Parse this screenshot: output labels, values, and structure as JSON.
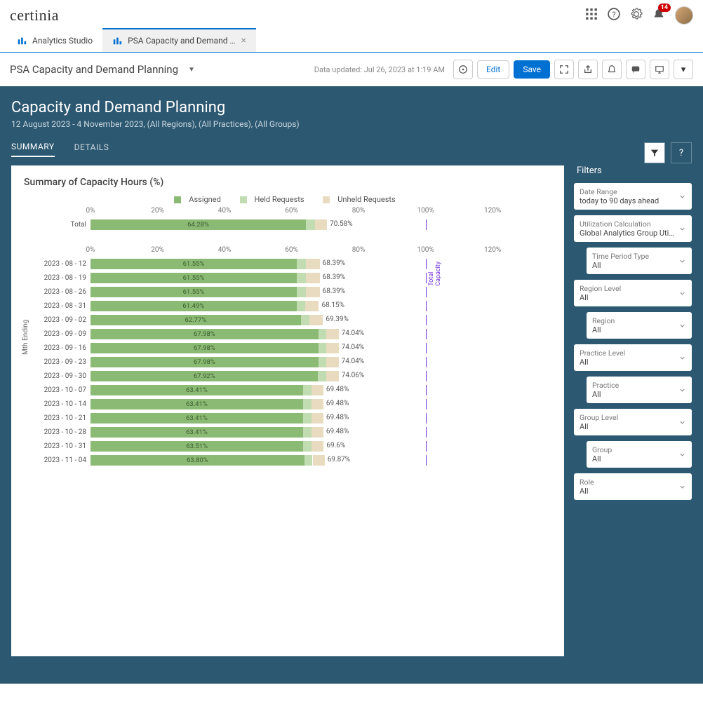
{
  "brand": "certinia",
  "notification_count": "14",
  "tabs": [
    {
      "label": "Analytics Studio",
      "active": false,
      "closeable": false
    },
    {
      "label": "PSA Capacity and Demand …",
      "active": true,
      "closeable": true
    }
  ],
  "dashboard_title": "PSA Capacity and Demand Planning",
  "data_updated": "Data updated: Jul 26, 2023 at 1:19 AM",
  "btn_edit": "Edit",
  "btn_save": "Save",
  "page_heading": "Capacity and Demand Planning",
  "page_sub": "12 August 2023 - 4 November 2023, (All Regions), (All Practices), (All Groups)",
  "page_tabs": {
    "summary": "SUMMARY",
    "details": "DETAILS"
  },
  "chart_title": "Summary of Capacity Hours (%)",
  "legend": {
    "assigned": "Assigned",
    "held": "Held Requests",
    "unheld": "Unheld Requests"
  },
  "axis_ticks": [
    "0%",
    "20%",
    "40%",
    "60%",
    "80%",
    "100%",
    "120%"
  ],
  "total_label": "Total",
  "y_axis_label": "Mth Ending",
  "total_capacity_label": "Total Capacity",
  "filters_heading": "Filters",
  "filters": [
    {
      "title": "Date Range",
      "value": "today to 90 days ahead",
      "indent": false
    },
    {
      "title": "Utilization Calculation",
      "value": "Global Analytics Group Utilizati",
      "indent": false
    },
    {
      "title": "Time Period Type",
      "value": "All",
      "indent": true
    },
    {
      "title": "Region Level",
      "value": "All",
      "indent": false
    },
    {
      "title": "Region",
      "value": "All",
      "indent": true
    },
    {
      "title": "Practice Level",
      "value": "All",
      "indent": false
    },
    {
      "title": "Practice",
      "value": "All",
      "indent": true
    },
    {
      "title": "Group Level",
      "value": "All",
      "indent": false
    },
    {
      "title": "Group",
      "value": "All",
      "indent": true
    },
    {
      "title": "Role",
      "value": "All",
      "indent": false
    }
  ],
  "chart_data": {
    "type": "bar",
    "orientation": "horizontal",
    "stacked": true,
    "xlabel": "",
    "ylabel": "Mth Ending",
    "xlim": [
      0,
      125
    ],
    "capacity_marker": 100,
    "series_names": [
      "Assigned",
      "Held Requests",
      "Unheld Requests"
    ],
    "total": {
      "label": "Total",
      "assigned": 64.28,
      "held": 2.7,
      "unheld": 3.6,
      "sum": 70.58
    },
    "rows": [
      {
        "label": "2023 - 08 - 12",
        "assigned": 61.55,
        "held": 2.8,
        "unheld": 4.04,
        "sum": 68.39
      },
      {
        "label": "2023 - 08 - 19",
        "assigned": 61.55,
        "held": 2.8,
        "unheld": 4.04,
        "sum": 68.39
      },
      {
        "label": "2023 - 08 - 26",
        "assigned": 61.55,
        "held": 2.8,
        "unheld": 4.04,
        "sum": 68.39
      },
      {
        "label": "2023 - 08 - 31",
        "assigned": 61.49,
        "held": 2.66,
        "unheld": 4.0,
        "sum": 68.15
      },
      {
        "label": "2023 - 09 - 02",
        "assigned": 62.77,
        "held": 2.62,
        "unheld": 4.0,
        "sum": 69.39
      },
      {
        "label": "2023 - 09 - 09",
        "assigned": 67.98,
        "held": 2.46,
        "unheld": 3.6,
        "sum": 74.04
      },
      {
        "label": "2023 - 09 - 16",
        "assigned": 67.98,
        "held": 2.46,
        "unheld": 3.6,
        "sum": 74.04
      },
      {
        "label": "2023 - 09 - 23",
        "assigned": 67.98,
        "held": 2.46,
        "unheld": 3.6,
        "sum": 74.04
      },
      {
        "label": "2023 - 09 - 30",
        "assigned": 67.92,
        "held": 2.5,
        "unheld": 3.64,
        "sum": 74.06
      },
      {
        "label": "2023 - 10 - 07",
        "assigned": 63.41,
        "held": 2.47,
        "unheld": 3.6,
        "sum": 69.48
      },
      {
        "label": "2023 - 10 - 14",
        "assigned": 63.41,
        "held": 2.47,
        "unheld": 3.6,
        "sum": 69.48
      },
      {
        "label": "2023 - 10 - 21",
        "assigned": 63.41,
        "held": 2.47,
        "unheld": 3.6,
        "sum": 69.48
      },
      {
        "label": "2023 - 10 - 28",
        "assigned": 63.41,
        "held": 2.47,
        "unheld": 3.6,
        "sum": 69.48
      },
      {
        "label": "2023 - 10 - 31",
        "assigned": 63.51,
        "held": 2.49,
        "unheld": 3.6,
        "sum": 69.6
      },
      {
        "label": "2023 - 11 - 04",
        "assigned": 63.8,
        "held": 2.47,
        "unheld": 3.6,
        "sum": 69.87
      }
    ]
  }
}
